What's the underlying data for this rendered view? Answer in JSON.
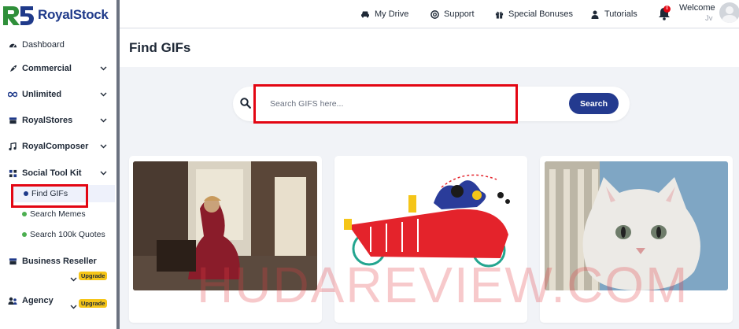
{
  "brand": {
    "name": "RoyalStock",
    "mark": "R5"
  },
  "sidebar": {
    "items": [
      {
        "label": "Dashboard",
        "icon": "gauge-icon"
      },
      {
        "label": "Commercial",
        "icon": "rocket-icon"
      },
      {
        "label": "Unlimited",
        "icon": "infinity-icon"
      },
      {
        "label": "RoyalStores",
        "icon": "store-icon"
      },
      {
        "label": "RoyalComposer",
        "icon": "music-icon"
      },
      {
        "label": "Social Tool Kit",
        "icon": "share-icon"
      },
      {
        "label": "Business Reseller",
        "icon": "box-icon",
        "badge": "Upgrade"
      },
      {
        "label": "Agency",
        "icon": "users-icon",
        "badge": "Upgrade"
      }
    ],
    "subitems": [
      {
        "label": "Find GIFs",
        "active": true
      },
      {
        "label": "Search Memes",
        "active": false
      },
      {
        "label": "Search 100k Quotes",
        "active": false
      }
    ]
  },
  "topbar": {
    "links": [
      {
        "label": "My Drive",
        "icon": "car-icon"
      },
      {
        "label": "Support",
        "icon": "lifebuoy-icon"
      },
      {
        "label": "Special Bonuses",
        "icon": "gift-icon"
      },
      {
        "label": "Tutorials",
        "icon": "user-icon"
      }
    ],
    "notification_count": "0",
    "welcome": "Welcome",
    "username": "Jv"
  },
  "page": {
    "title": "Find GIFs"
  },
  "search": {
    "placeholder": "Search GIFS here...",
    "button_label": "Search"
  },
  "gifs": [
    {
      "subject": "woman-in-red-dress"
    },
    {
      "subject": "vintage-car-illustration"
    },
    {
      "subject": "cat-leaning-tower"
    }
  ],
  "watermark": "HUDAREVIEW.COM",
  "colors": {
    "accent": "#233a8f",
    "highlight": "#e30613",
    "upgrade": "#f5c518",
    "dot": "#4caf50"
  }
}
